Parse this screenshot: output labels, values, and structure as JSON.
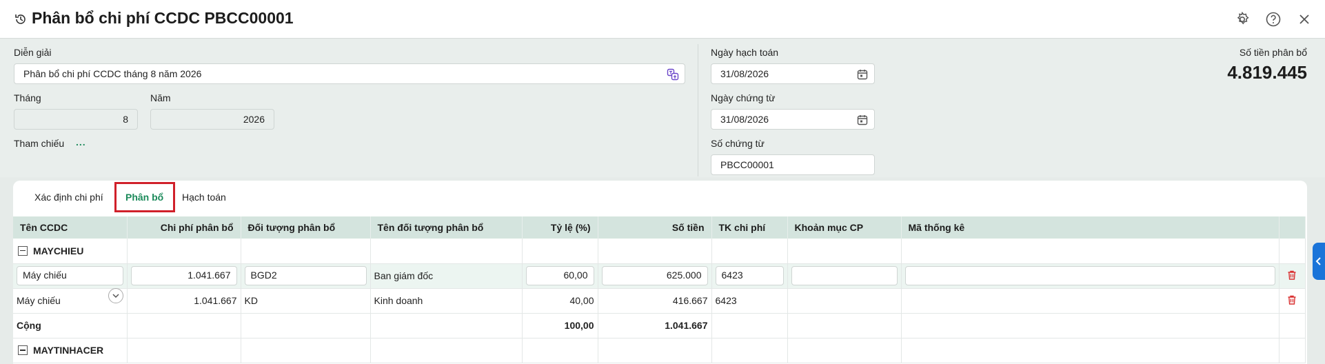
{
  "window": {
    "title": "Phân bổ chi phí CCDC PBCC00001",
    "icons": [
      "history-icon",
      "gear-icon",
      "help-icon",
      "close-icon"
    ]
  },
  "form": {
    "description_label": "Diễn giải",
    "description_value": "Phân bổ chi phí CCDC tháng 8 năm 2026",
    "month_label": "Tháng",
    "month_value": "8",
    "year_label": "Năm",
    "year_value": "2026",
    "reference_label": "Tham chiếu",
    "reference_link": "...",
    "posting_date_label": "Ngày hạch toán",
    "posting_date_value": "31/08/2026",
    "voucher_date_label": "Ngày chứng từ",
    "voucher_date_value": "31/08/2026",
    "voucher_no_label": "Số chứng từ",
    "voucher_no_value": "PBCC00001",
    "amount_label": "Số tiền phân bổ",
    "amount_value": "4.819.445"
  },
  "tabs": [
    {
      "label": "Xác định chi phí",
      "active": false
    },
    {
      "label": "Phân bổ",
      "active": true
    },
    {
      "label": "Hạch toán",
      "active": false
    }
  ],
  "table": {
    "headers": [
      "Tên CCDC",
      "Chi phí phân bổ",
      "Đối tượng phân bổ",
      "Tên đối tượng phân bổ",
      "Tỷ lệ (%)",
      "Số tiền",
      "TK chi phí",
      "Khoản mục CP",
      "Mã thống kê"
    ],
    "group1": "MAYCHIEU",
    "rows": [
      {
        "name": "Máy chiếu",
        "cost": "1.041.667",
        "object": "BGD2",
        "object_name": "Ban giám đốc",
        "rate": "60,00",
        "amount": "625.000",
        "account": "6423",
        "item": "",
        "stat": ""
      },
      {
        "name": "Máy chiếu",
        "cost": "1.041.667",
        "object": "KD",
        "object_name": "Kinh doanh",
        "rate": "40,00",
        "amount": "416.667",
        "account": "6423",
        "item": "",
        "stat": ""
      }
    ],
    "total_label": "Cộng",
    "total_rate": "100,00",
    "total_amount": "1.041.667",
    "group2": "MAYTINHACER"
  },
  "colors": {
    "accent": "#1b8a5a",
    "header_bg": "#d4e4de",
    "highlight": "#d0202a",
    "side_tab": "#1a74d9",
    "trash": "#d93030"
  }
}
